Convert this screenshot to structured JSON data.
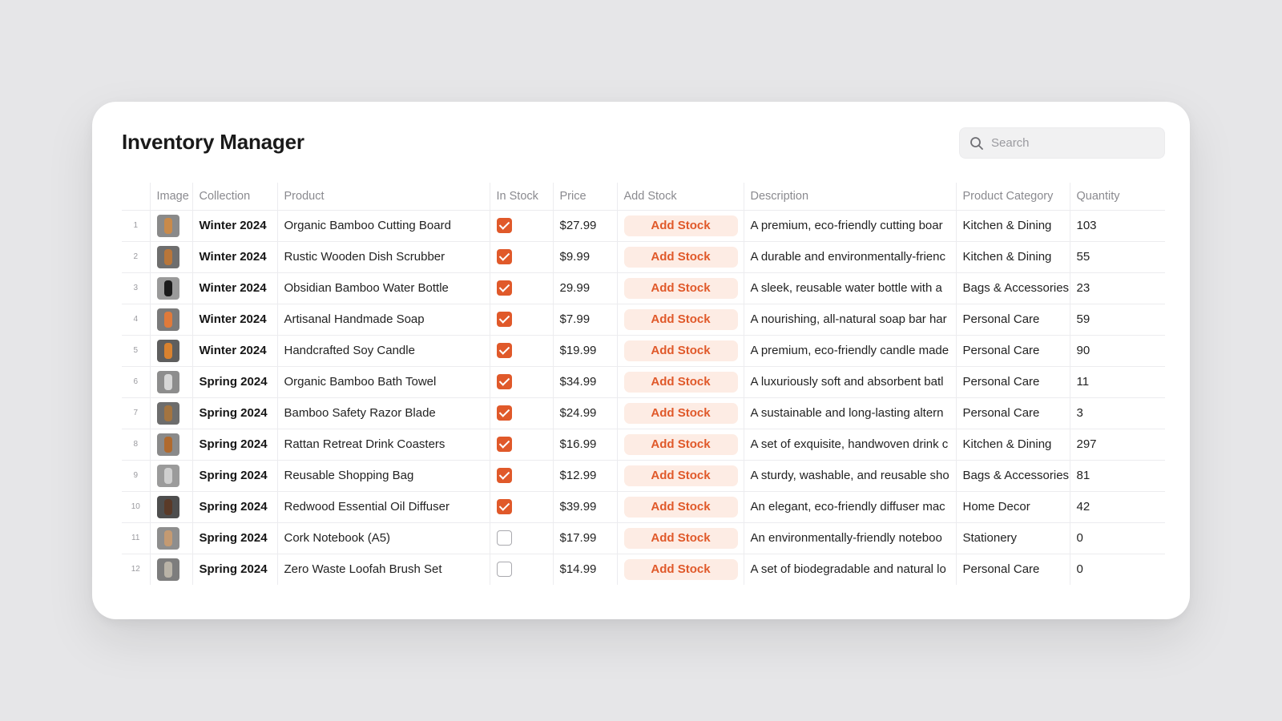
{
  "app": {
    "title": "Inventory Manager"
  },
  "search": {
    "placeholder": "Search",
    "value": ""
  },
  "colors": {
    "accent": "#e0592a",
    "accent_soft": "#fdece4"
  },
  "table": {
    "headers": {
      "image": "Image",
      "collection": "Collection",
      "product": "Product",
      "in_stock": "In Stock",
      "price": "Price",
      "add_stock": "Add Stock",
      "description": "Description",
      "category": "Product Category",
      "quantity": "Quantity"
    },
    "button_label": "Add Stock",
    "rows": [
      {
        "num": "1",
        "image_icon": "cutting-board-icon",
        "collection": "Winter 2024",
        "product": "Organic Bamboo Cutting Board",
        "in_stock": true,
        "price": "$27.99",
        "description": "A premium, eco-friendly cutting boar",
        "category": "Kitchen & Dining",
        "quantity": "103"
      },
      {
        "num": "2",
        "image_icon": "dish-scrubber-icon",
        "collection": "Winter 2024",
        "product": "Rustic Wooden Dish Scrubber",
        "in_stock": true,
        "price": "$9.99",
        "description": "A durable and environmentally-frienc",
        "category": "Kitchen & Dining",
        "quantity": "55"
      },
      {
        "num": "3",
        "image_icon": "water-bottle-icon",
        "collection": "Winter 2024",
        "product": "Obsidian Bamboo Water Bottle",
        "in_stock": true,
        "price": "29.99",
        "description": "A sleek, reusable water bottle with a",
        "category": "Bags & Accessories",
        "quantity": "23"
      },
      {
        "num": "4",
        "image_icon": "soap-icon",
        "collection": "Winter 2024",
        "product": "Artisanal Handmade Soap",
        "in_stock": true,
        "price": "$7.99",
        "description": "A nourishing, all-natural soap bar har",
        "category": "Personal Care",
        "quantity": "59"
      },
      {
        "num": "5",
        "image_icon": "candle-icon",
        "collection": "Winter 2024",
        "product": "Handcrafted Soy Candle",
        "in_stock": true,
        "price": "$19.99",
        "description": "A premium, eco-friendly candle made",
        "category": "Personal Care",
        "quantity": "90"
      },
      {
        "num": "6",
        "image_icon": "bath-towel-icon",
        "collection": "Spring 2024",
        "product": "Organic Bamboo Bath Towel",
        "in_stock": true,
        "price": "$34.99",
        "description": "A luxuriously soft and absorbent batl",
        "category": "Personal Care",
        "quantity": "11"
      },
      {
        "num": "7",
        "image_icon": "razor-icon",
        "collection": "Spring 2024",
        "product": "Bamboo Safety Razor Blade",
        "in_stock": true,
        "price": "$24.99",
        "description": "A sustainable and long-lasting altern",
        "category": "Personal Care",
        "quantity": "3"
      },
      {
        "num": "8",
        "image_icon": "coasters-icon",
        "collection": "Spring 2024",
        "product": "Rattan Retreat Drink Coasters",
        "in_stock": true,
        "price": "$16.99",
        "description": "A set of exquisite, handwoven drink c",
        "category": "Kitchen & Dining",
        "quantity": "297"
      },
      {
        "num": "9",
        "image_icon": "shopping-bag-icon",
        "collection": "Spring 2024",
        "product": "Reusable Shopping Bag",
        "in_stock": true,
        "price": "$12.99",
        "description": "A sturdy, washable, and reusable sho",
        "category": "Bags & Accessories",
        "quantity": "81"
      },
      {
        "num": "10",
        "image_icon": "oil-diffuser-icon",
        "collection": "Spring 2024",
        "product": "Redwood Essential Oil Diffuser",
        "in_stock": true,
        "price": "$39.99",
        "description": "An elegant, eco-friendly diffuser mac",
        "category": "Home Decor",
        "quantity": "42"
      },
      {
        "num": "11",
        "image_icon": "notebook-icon",
        "collection": "Spring 2024",
        "product": "Cork Notebook (A5)",
        "in_stock": false,
        "price": "$17.99",
        "description": "An environmentally-friendly noteboo",
        "category": "Stationery",
        "quantity": "0"
      },
      {
        "num": "12",
        "image_icon": "loofah-brush-icon",
        "collection": "Spring 2024",
        "product": "Zero Waste Loofah Brush Set",
        "in_stock": false,
        "price": "$14.99",
        "description": "A set of biodegradable and natural lo",
        "category": "Personal Care",
        "quantity": "0"
      }
    ]
  }
}
